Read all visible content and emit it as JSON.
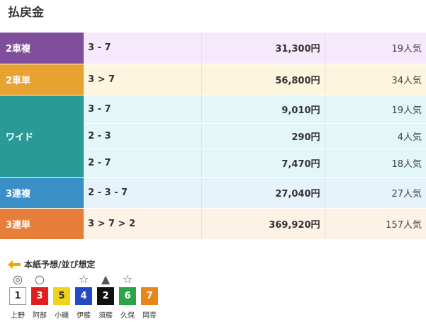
{
  "page": {
    "title": "払戻金"
  },
  "payouts": [
    {
      "label": "2車複",
      "color": "#7f4f9d",
      "bg": "#f6e9fb",
      "rows": [
        {
          "combo": "3 - 7",
          "amount": "31,300円",
          "pop": "19人気"
        }
      ]
    },
    {
      "label": "2車単",
      "color": "#e8a232",
      "bg": "#fdf6df",
      "rows": [
        {
          "combo": "3 > 7",
          "amount": "56,800円",
          "pop": "34人気"
        }
      ]
    },
    {
      "label": "ワイド",
      "color": "#2a9a97",
      "bg": "#e3f6f8",
      "rows": [
        {
          "combo": "3 - 7",
          "amount": "9,010円",
          "pop": "19人気"
        },
        {
          "combo": "2 - 3",
          "amount": "290円",
          "pop": "4人気"
        },
        {
          "combo": "2 - 7",
          "amount": "7,470円",
          "pop": "18人気"
        }
      ]
    },
    {
      "label": "3連複",
      "color": "#3a8fc6",
      "bg": "#e6f3fb",
      "rows": [
        {
          "combo": "2 - 3 - 7",
          "amount": "27,040円",
          "pop": "27人気"
        }
      ]
    },
    {
      "label": "3連単",
      "color": "#e67e3a",
      "bg": "#fdf2e6",
      "rows": [
        {
          "combo": "3 > 7 > 2",
          "amount": "369,920円",
          "pop": "157人気"
        }
      ]
    }
  ],
  "prediction": {
    "heading": "本紙予想/並び想定",
    "riders": [
      {
        "num": "1",
        "name": "上野",
        "mark": "◎",
        "bg": "#ffffff",
        "fg": "#333333",
        "border": "#999999"
      },
      {
        "num": "3",
        "name": "阿部",
        "mark": "○",
        "bg": "#e02020",
        "fg": "#ffffff",
        "border": "#e02020"
      },
      {
        "num": "5",
        "name": "小磯",
        "mark": "",
        "bg": "#f2d21b",
        "fg": "#333333",
        "border": "#f2d21b"
      },
      {
        "num": "4",
        "name": "伊藤",
        "mark": "☆",
        "bg": "#2448c6",
        "fg": "#ffffff",
        "border": "#2448c6"
      },
      {
        "num": "2",
        "name": "須藤",
        "mark": "▲",
        "bg": "#111111",
        "fg": "#ffffff",
        "border": "#111111"
      },
      {
        "num": "6",
        "name": "久保",
        "mark": "☆",
        "bg": "#2aa54a",
        "fg": "#ffffff",
        "border": "#2aa54a"
      },
      {
        "num": "7",
        "name": "岡嵜",
        "mark": "",
        "bg": "#e8861e",
        "fg": "#ffffff",
        "border": "#e8861e"
      }
    ]
  }
}
